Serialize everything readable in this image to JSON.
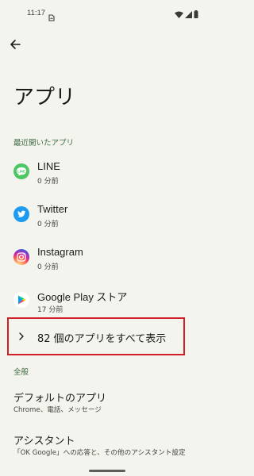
{
  "status_bar": {
    "time": "11:17"
  },
  "header": {
    "title": "アプリ"
  },
  "recent_section": {
    "title": "最近開いたアプリ",
    "apps": [
      {
        "name": "LINE",
        "time": "0 分前",
        "icon": "line-icon",
        "color": "#4cc764"
      },
      {
        "name": "Twitter",
        "time": "0 分前",
        "icon": "twitter-icon",
        "color": "#1d9bf0"
      },
      {
        "name": "Instagram",
        "time": "0 分前",
        "icon": "instagram-icon",
        "color": "#c13584"
      },
      {
        "name": "Google Play ストア",
        "time": "17 分前",
        "icon": "google-play-icon",
        "color": "#ffffff"
      }
    ],
    "see_all_label": "82 個のアプリをすべて表示"
  },
  "general_section": {
    "title": "全般",
    "items": [
      {
        "title": "デフォルトのアプリ",
        "subtitle": "Chrome、電話、メッセージ"
      },
      {
        "title": "アシスタント",
        "subtitle": "「OK Google」への応答と、その他のアシスタント設定"
      }
    ]
  },
  "colors": {
    "background": "#f3f4ed",
    "section_header": "#3e6a43",
    "highlight_border": "#d21e28"
  }
}
